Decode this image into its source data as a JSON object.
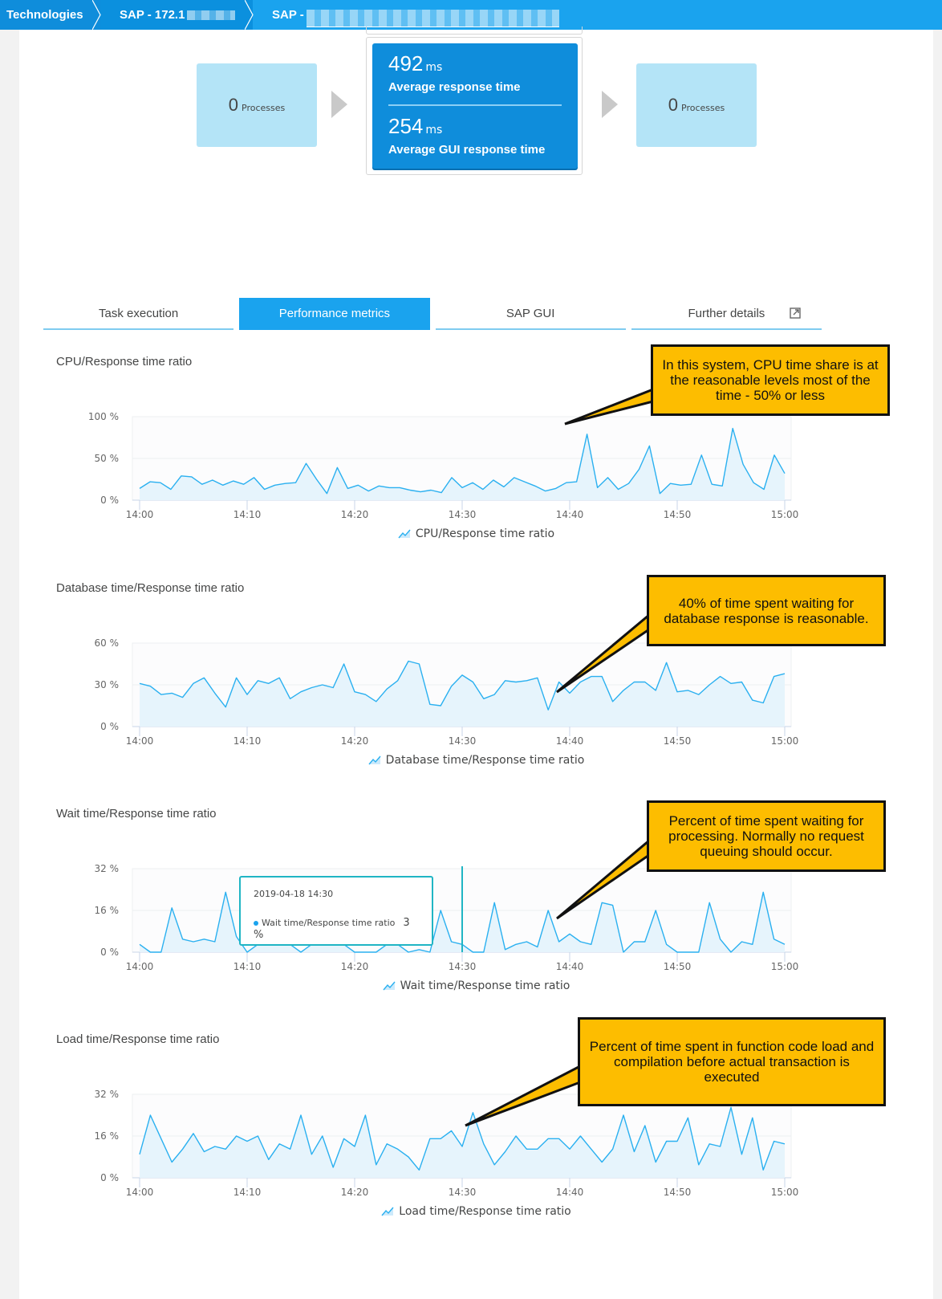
{
  "breadcrumb": {
    "items": [
      {
        "label": "Technologies"
      },
      {
        "label": "SAP - 172.1"
      },
      {
        "label": "SAP - "
      }
    ]
  },
  "flow": {
    "left": {
      "count": "0",
      "unit": "Processes"
    },
    "right": {
      "count": "0",
      "unit": "Processes"
    },
    "center": {
      "metrics": [
        {
          "value": "492",
          "unit": "ms",
          "label": "Average response time"
        },
        {
          "value": "254",
          "unit": "ms",
          "label": "Average GUI response time"
        }
      ]
    }
  },
  "tabs": [
    {
      "label": "Task execution",
      "active": false
    },
    {
      "label": "Performance metrics",
      "active": true
    },
    {
      "label": "SAP GUI",
      "active": false
    },
    {
      "label": "Further details",
      "active": false,
      "icon": "external-link-icon"
    }
  ],
  "colors": {
    "accent": "#1aa3ee",
    "header_dark": "#0f8ddb",
    "line": "#2ab0f0",
    "fill": "#e6f4fc",
    "callout": "#fdbd00",
    "tooltip_border": "#20b5c4"
  },
  "callouts": [
    {
      "text": "In this system, CPU time share is at the reasonable levels most of the time -  50% or less"
    },
    {
      "text": "40% of time spent waiting for database response is reasonable."
    },
    {
      "text": "Percent of time spent waiting for processing. Normally no request queuing should occur."
    },
    {
      "text": "Percent of time spent in function code load and compilation before actual transaction is executed"
    }
  ],
  "tooltip": {
    "date": "2019-04-18 14:30",
    "series": "Wait time/Response time ratio",
    "value": "3 %"
  },
  "chart_data": [
    {
      "type": "area",
      "title": "CPU/Response time ratio",
      "legend": "CPU/Response time ratio",
      "legend_position": "bottom-center",
      "x_ticks": [
        "14:00",
        "14:10",
        "14:20",
        "14:30",
        "14:40",
        "14:50",
        "15:00"
      ],
      "y_ticks": [
        "0 %",
        "50 %",
        "100 %"
      ],
      "ylim": [
        0,
        100
      ],
      "x_start_minute": 0,
      "x_end_minute": 60,
      "values": [
        14,
        22,
        21,
        13,
        29,
        28,
        19,
        24,
        18,
        23,
        19,
        27,
        13,
        18,
        20,
        21,
        44,
        25,
        8,
        39,
        14,
        18,
        11,
        17,
        15,
        15,
        12,
        10,
        12,
        9,
        27,
        15,
        21,
        13,
        24,
        16,
        27,
        22,
        17,
        11,
        14,
        21,
        22,
        79,
        15,
        27,
        13,
        20,
        37,
        65,
        8,
        20,
        18,
        19,
        54,
        19,
        17,
        86,
        43,
        21,
        13,
        54,
        32
      ]
    },
    {
      "type": "area",
      "title": "Database time/Response time ratio",
      "legend": "Database time/Response time ratio",
      "legend_position": "bottom-center",
      "x_ticks": [
        "14:00",
        "14:10",
        "14:20",
        "14:30",
        "14:40",
        "14:50",
        "15:00"
      ],
      "y_ticks": [
        "0 %",
        "30 %",
        "60 %"
      ],
      "ylim": [
        0,
        60
      ],
      "x_start_minute": 0,
      "x_end_minute": 60,
      "values": [
        31,
        29,
        23,
        24,
        21,
        31,
        35,
        24,
        14,
        35,
        23,
        33,
        31,
        35,
        20,
        25,
        28,
        30,
        28,
        45,
        25,
        23,
        18,
        27,
        33,
        47,
        45,
        16,
        15,
        29,
        37,
        32,
        20,
        23,
        33,
        32,
        33,
        35,
        12,
        32,
        24,
        32,
        36,
        36,
        18,
        26,
        32,
        32,
        26,
        46,
        25,
        26,
        23,
        30,
        36,
        31,
        32,
        19,
        17,
        36,
        38
      ]
    },
    {
      "type": "area",
      "title": "Wait time/Response time ratio",
      "legend": "Wait time/Response time ratio",
      "legend_position": "bottom-center",
      "x_ticks": [
        "14:00",
        "14:10",
        "14:20",
        "14:30",
        "14:40",
        "14:50",
        "15:00"
      ],
      "y_ticks": [
        "0 %",
        "16 %",
        "32 %"
      ],
      "ylim": [
        0,
        32
      ],
      "x_start_minute": 0,
      "x_end_minute": 60,
      "values": [
        3,
        0,
        0,
        17,
        5,
        4,
        5,
        4,
        23,
        6,
        0,
        3,
        3,
        3,
        3,
        0,
        3,
        3,
        3,
        3,
        0,
        0,
        0,
        3,
        3,
        0,
        1,
        0,
        16,
        4,
        3,
        0,
        0,
        19,
        1,
        3,
        4,
        2,
        16,
        4,
        7,
        4,
        3,
        19,
        18,
        0,
        4,
        4,
        16,
        3,
        0,
        0,
        0,
        19,
        5,
        0,
        4,
        3,
        23,
        5,
        3
      ]
    },
    {
      "type": "area",
      "title": "Load time/Response time ratio",
      "legend": "Load time/Response time ratio",
      "legend_position": "bottom-center",
      "x_ticks": [
        "14:00",
        "14:10",
        "14:20",
        "14:30",
        "14:40",
        "14:50",
        "15:00"
      ],
      "y_ticks": [
        "0 %",
        "16 %",
        "32 %"
      ],
      "ylim": [
        0,
        32
      ],
      "x_start_minute": 0,
      "x_end_minute": 60,
      "values": [
        9,
        24,
        15,
        6,
        11,
        17,
        10,
        12,
        11,
        16,
        14,
        16,
        7,
        13,
        11,
        24,
        9,
        16,
        4,
        15,
        12,
        24,
        5,
        13,
        11,
        8,
        3,
        15,
        15,
        18,
        12,
        25,
        13,
        5,
        10,
        16,
        11,
        11,
        15,
        15,
        11,
        16,
        11,
        6,
        11,
        24,
        10,
        20,
        6,
        14,
        14,
        23,
        5,
        13,
        12,
        27,
        9,
        23,
        3,
        14,
        13
      ]
    }
  ]
}
